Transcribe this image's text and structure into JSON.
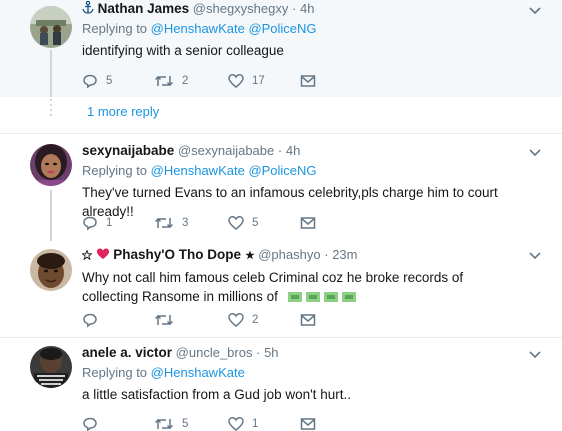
{
  "tweets": [
    {
      "fullname": "Nathan James",
      "handle": "@shegxyshegxy",
      "time": "4h",
      "replying_prefix": "Replying to",
      "mentions": [
        "@HenshawKate",
        "@PoliceNG"
      ],
      "text": "identifying with a senior colleague",
      "reply_count": "5",
      "retweet_count": "2",
      "like_count": "17",
      "prefix_icon": "anchor-icon"
    },
    {
      "fullname": "sexynaijababe",
      "handle": "@sexynaijababe",
      "time": "4h",
      "replying_prefix": "Replying to",
      "mentions": [
        "@HenshawKate",
        "@PoliceNG"
      ],
      "text": "They've turned Evans to an infamous celebrity,pls charge him to court already!!",
      "reply_count": "1",
      "retweet_count": "3",
      "like_count": "5"
    },
    {
      "fullname": "Phashy'O Tho Dope",
      "handle": "@phashyo",
      "time": "23m",
      "text": "Why not call him famous celeb Criminal coz he broke records of collecting Ransome in millions of",
      "reply_count": "",
      "retweet_count": "",
      "like_count": "2",
      "emoji": "money-bag-emoji"
    },
    {
      "fullname": "anele a. victor",
      "handle": "@uncle_bros",
      "time": "5h",
      "replying_prefix": "Replying to",
      "mentions": [
        "@HenshawKate"
      ],
      "text": "a little satisfaction from a Gud job won't hurt..",
      "reply_count": "",
      "retweet_count": "5",
      "like_count": "1"
    }
  ],
  "more_reply": "1 more reply",
  "separator": "·",
  "colors": {
    "link": "#1b95e0",
    "secondary": "#657786",
    "highlight_bg": "#f5f8fa",
    "divider": "#e6ecf0",
    "heart_red": "#e0245e"
  }
}
